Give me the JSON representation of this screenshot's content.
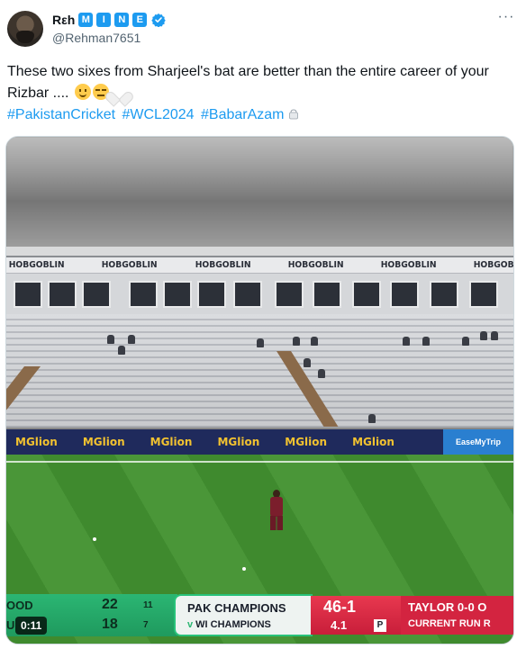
{
  "author": {
    "display_name_prefix": "Rεh",
    "display_name_letters": [
      "M",
      "I",
      "N",
      "E"
    ],
    "handle": "@Rehman7651",
    "verified": true,
    "avatar_icon": "profile-photo"
  },
  "post": {
    "text": "These two sixes from Sharjeel's bat are better than the entire career of your Rizbar ....",
    "emojis": [
      "slightly-smiling-face",
      "expressionless-face",
      "white-heart"
    ],
    "hashtags": [
      "#PakistanCricket",
      "#WCL2024",
      "#BabarAzam"
    ],
    "trailing_icon": "handbag-icon"
  },
  "video": {
    "timestamp": "0:11",
    "stadium_banner": "HOBGOBLIN",
    "ad_board": "MGlion",
    "ad_board_right": "EaseMyTrip",
    "scoreboard": {
      "batter1_name": "OOD",
      "batter1_runs": "22",
      "batter1_balls": "11",
      "batter2_name": "U",
      "batter2_runs": "18",
      "batter2_balls": "7",
      "team1": "PAK CHAMPIONS",
      "team2": "WI CHAMPIONS",
      "team2_prefix": "v",
      "score": "46-1",
      "overs": "4.1",
      "powerplay": "P",
      "bowler": "TAYLOR 0-0 O",
      "current_run_rate": "CURRENT RUN R"
    }
  },
  "colors": {
    "link": "#1d9bf0",
    "text": "#0f1419",
    "secondary": "#536471"
  }
}
